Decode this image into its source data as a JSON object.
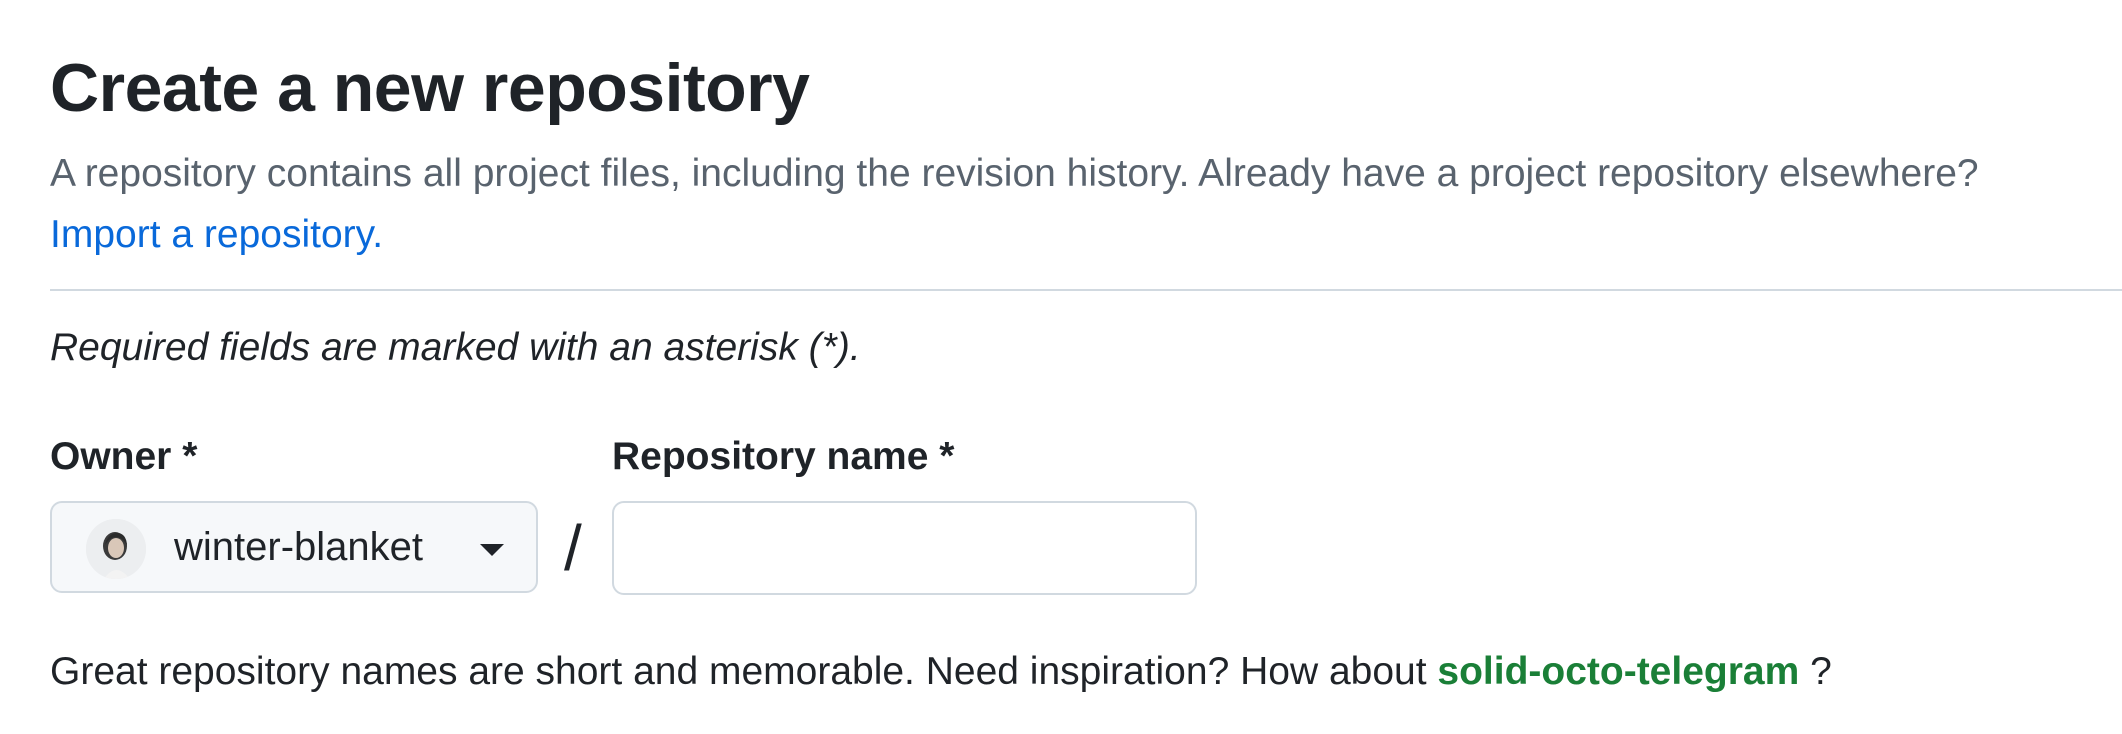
{
  "header": {
    "title": "Create a new repository",
    "subtitle": "A repository contains all project files, including the revision history. Already have a project repository elsewhere?",
    "import_link": "Import a repository."
  },
  "form": {
    "required_note": "Required fields are marked with an asterisk (*).",
    "owner": {
      "label": "Owner *",
      "selected": "winter-blanket",
      "icon": "chevron-down-icon"
    },
    "separator": "/",
    "repository_name": {
      "label": "Repository name *",
      "value": "",
      "placeholder": ""
    },
    "hint": {
      "prefix": "Great repository names are short and memorable. Need inspiration? How about",
      "suggestion": "solid-octo-telegram",
      "suffix": "?"
    }
  },
  "colors": {
    "text": "#1f2328",
    "muted": "#59636e",
    "link": "#0969da",
    "success": "#1a7f37",
    "border": "#d1d9e0"
  }
}
